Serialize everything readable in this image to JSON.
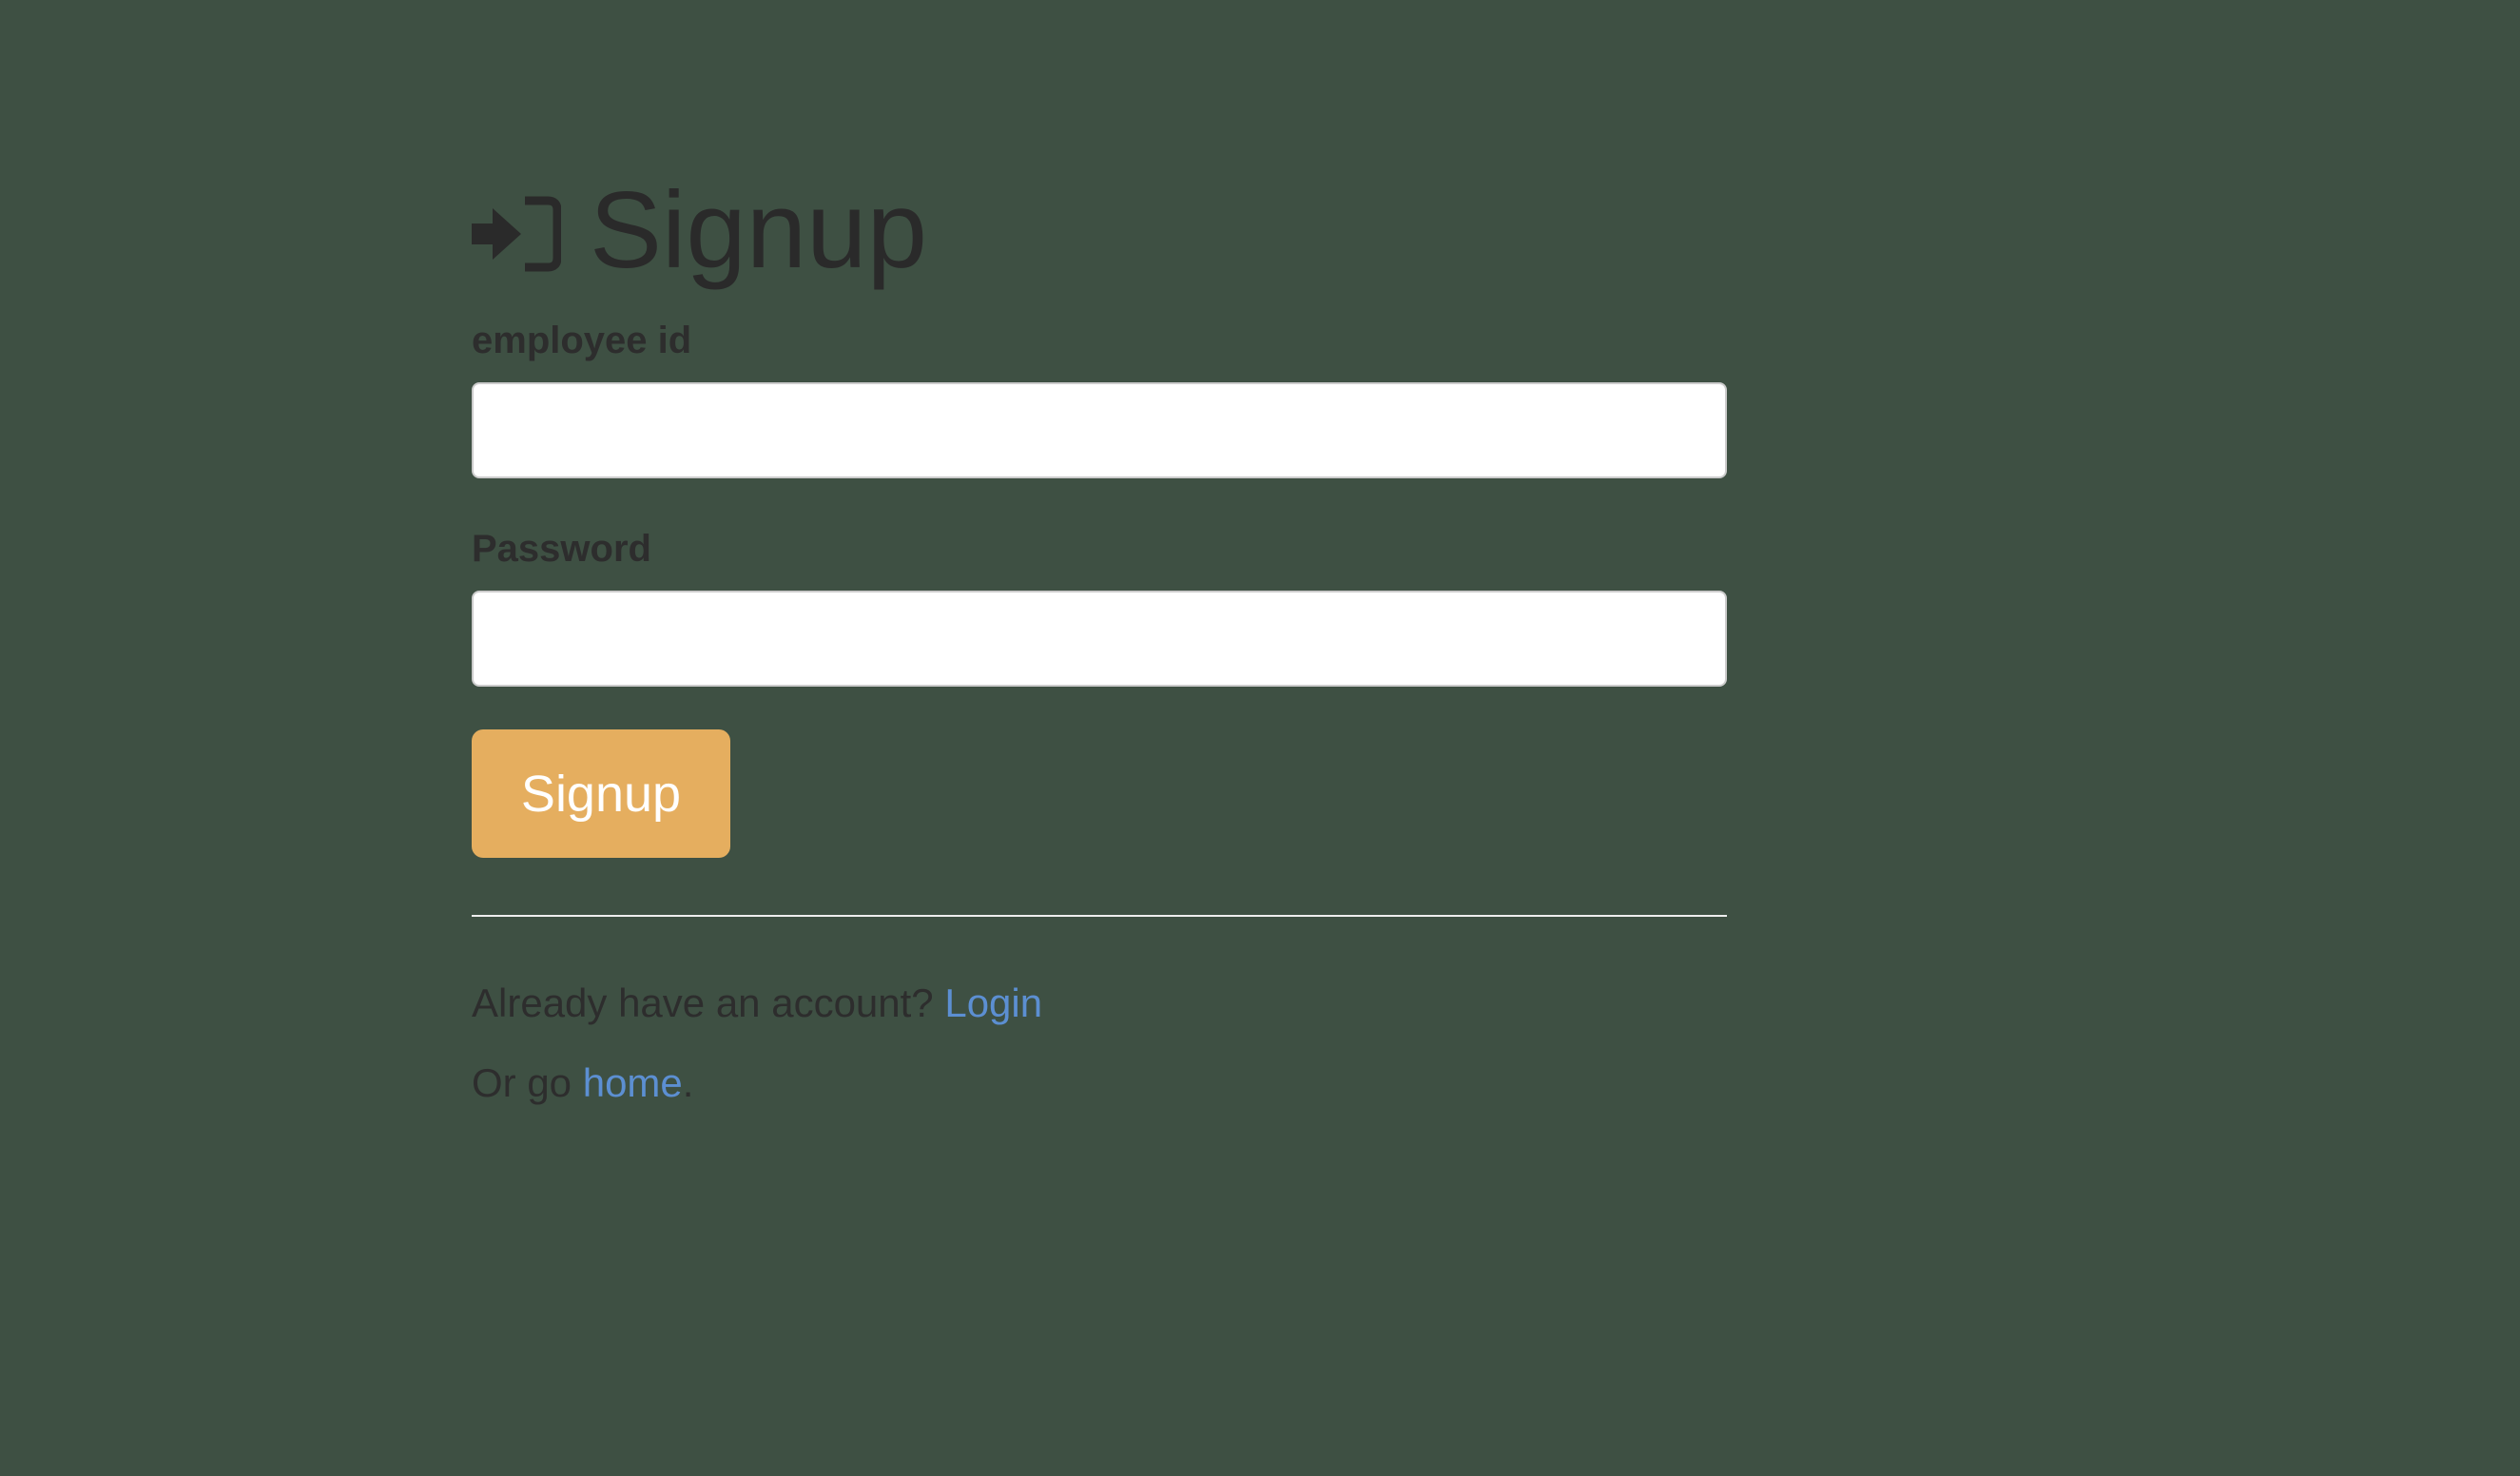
{
  "heading": {
    "icon": "sign-in-icon",
    "title": "Signup"
  },
  "form": {
    "employee_id_label": "employee id",
    "employee_id_value": "",
    "password_label": "Password",
    "password_value": "",
    "submit_label": "Signup"
  },
  "footer": {
    "login_prompt": "Already have an account?",
    "login_link": "Login",
    "home_prefix": "Or go",
    "home_link": "home",
    "home_suffix": "."
  },
  "colors": {
    "background": "#3e5043",
    "button": "#e5ae5f",
    "link": "#5c8fd2",
    "text": "#2d2d2d"
  }
}
